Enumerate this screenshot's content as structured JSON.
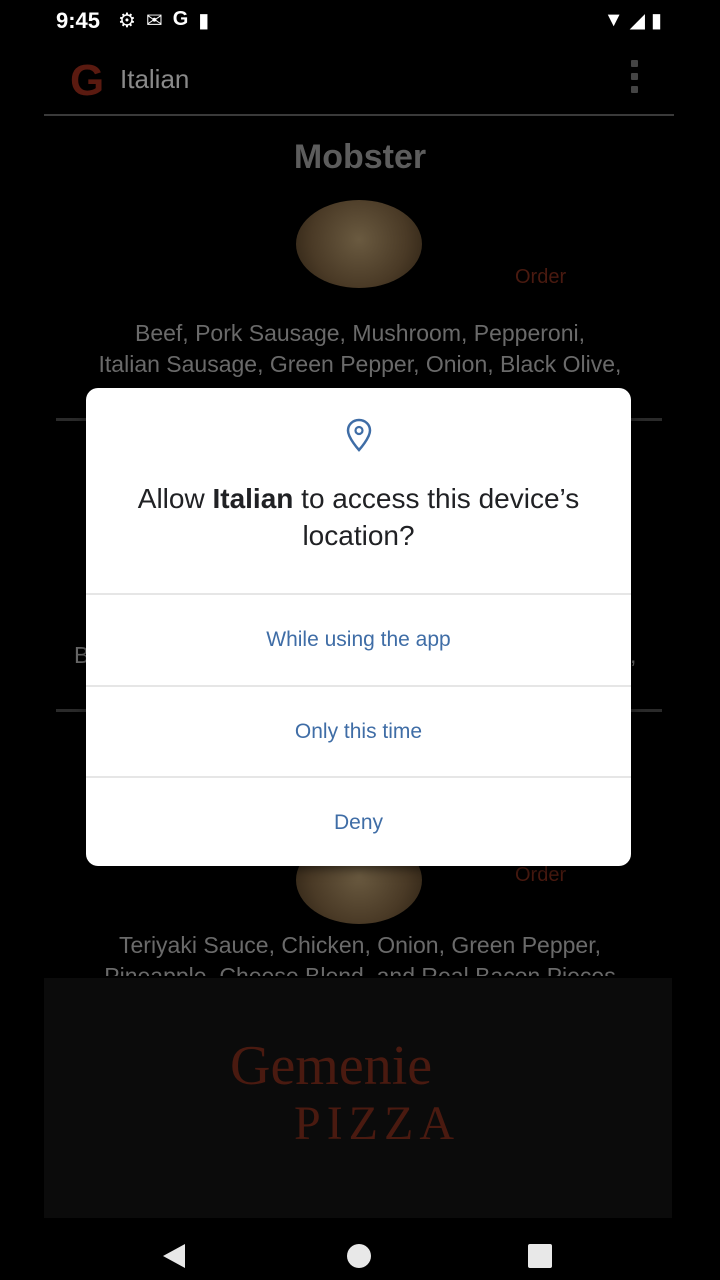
{
  "status": {
    "time": "9:45",
    "left_icons": [
      "gear-icon",
      "mail-icon",
      "g-icon",
      "sd-card-icon"
    ],
    "right_icons": [
      "wifi-icon",
      "signal-icon",
      "battery-icon"
    ]
  },
  "appbar": {
    "logo": "G",
    "title": "Italian"
  },
  "content": {
    "pizza1_title": "Mobster",
    "pizza1_order": "Order",
    "pizza1_ingredients_line1": "Beef, Pork Sausage, Mushroom, Pepperoni,",
    "pizza1_ingredients_line2": "Italian Sausage, Green Pepper, Onion, Black Olive,",
    "pizza2_partial_left": "B",
    "pizza2_partial_right": ",",
    "pizza3_order": "Order",
    "pizza3_ingredients_line1": "Teriyaki Sauce, Chicken, Onion, Green Pepper,",
    "pizza3_ingredients_line2": "Pineapple, Cheese Blend, and Real Bacon Pieces"
  },
  "footer": {
    "brand_line1": "Gemenie",
    "brand_line2": "PIZZA"
  },
  "dialog": {
    "message_prefix": "Allow ",
    "app_name": "Italian",
    "message_suffix": " to access this device’s location?",
    "btn_while_using": "While using the app",
    "btn_only_this_time": "Only this time",
    "btn_deny": "Deny",
    "accent": "#3f6da6"
  }
}
